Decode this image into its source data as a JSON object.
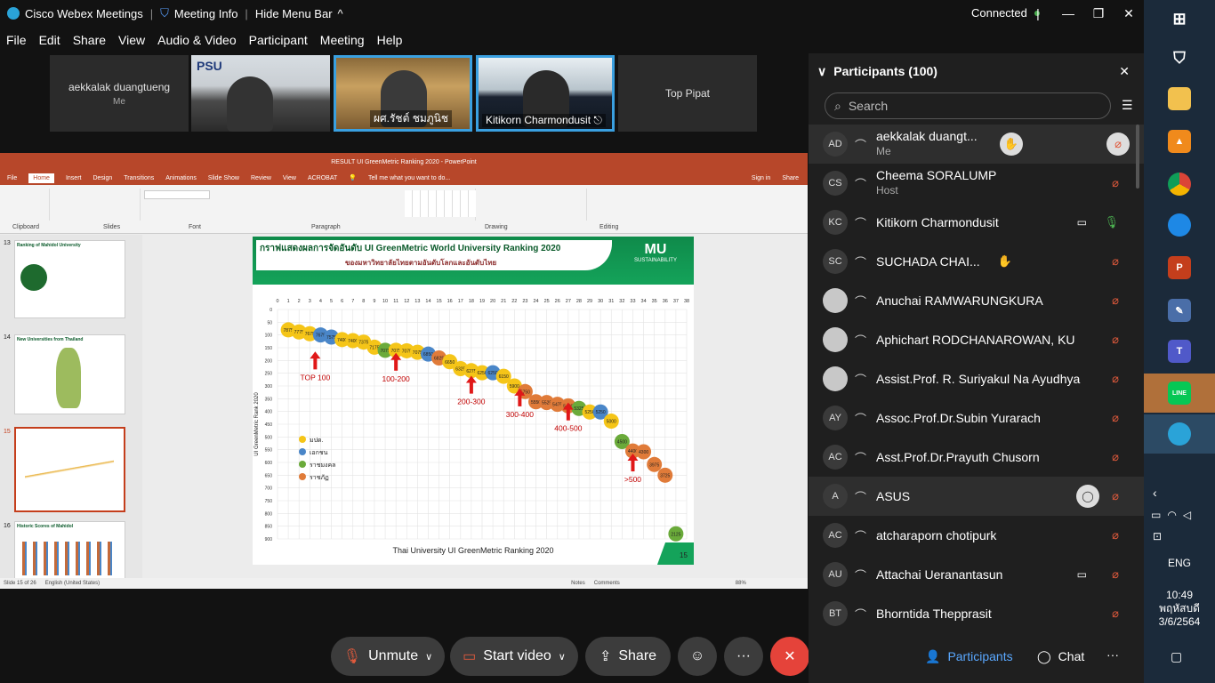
{
  "titlebar": {
    "app": "Cisco Webex Meetings",
    "meeting_info": "Meeting Info",
    "hide_menu": "Hide Menu Bar",
    "status": "Connected"
  },
  "menu": [
    "File",
    "Edit",
    "Share",
    "View",
    "Audio & Video",
    "Participant",
    "Meeting",
    "Help"
  ],
  "videos": [
    {
      "name": "aekkalak duangtueng",
      "sub": "Me"
    },
    {
      "name": "",
      "sub": ""
    },
    {
      "name": "ผศ.รัชต์ ชมภูนิช",
      "sub": ""
    },
    {
      "name": "Kitikorn Charmondusit",
      "sub": ""
    },
    {
      "name": "Top Pipat",
      "sub": ""
    }
  ],
  "ppt": {
    "window_title": "RESULT UI GreenMetric Ranking 2020 - PowerPoint",
    "tabs": [
      "File",
      "Home",
      "Insert",
      "Design",
      "Transitions",
      "Animations",
      "Slide Show",
      "Review",
      "View",
      "ACROBAT"
    ],
    "tell_me": "Tell me what you want to do...",
    "signin": "Sign in",
    "share": "Share",
    "groups": [
      "Clipboard",
      "Slides",
      "Font",
      "Paragraph",
      "Drawing",
      "Editing"
    ],
    "status": "Slide 15 of 26",
    "language": "English (United States)",
    "notes": "Notes",
    "comments": "Comments",
    "zoom": "88%",
    "thumbs": [
      {
        "num": "13",
        "title": "Ranking of Mahidol University"
      },
      {
        "num": "14",
        "title": "New Universities from Thailand"
      },
      {
        "num": "15",
        "title": ""
      },
      {
        "num": "16",
        "title": "Historic Scores of Mahidol"
      }
    ]
  },
  "slide": {
    "title_line1": "กราฟแสดงผลการจัดอันดับ UI GreenMetric World University Ranking 2020",
    "title_line2": "ของมหาวิทยาลัยไทยตามอันดับโลกและอันดับไทย",
    "logo_text": "MU",
    "logo_sub": "SUSTAINABILITY",
    "caption": "Thai University UI GreenMetric Ranking 2020",
    "page_no": "15",
    "legend": [
      "มปด.",
      "เอกชน",
      "ราชมงคล",
      "ราชภัฏ"
    ],
    "legend_colors": [
      "#f5c518",
      "#4a86c8",
      "#6aaa3a",
      "#e07b39"
    ],
    "bands": [
      "TOP 100",
      "100-200",
      "200-300",
      "300-400",
      "400-500",
      ">500"
    ]
  },
  "chart_data": {
    "type": "scatter",
    "title": "",
    "xlabel": "",
    "ylabel": "UI GreenMetric Rank 2020",
    "xlim": [
      0,
      38
    ],
    "ylim": [
      0,
      900
    ],
    "x_ticks": [
      0,
      1,
      2,
      3,
      4,
      5,
      6,
      7,
      8,
      9,
      10,
      11,
      12,
      13,
      14,
      15,
      16,
      17,
      18,
      19,
      20,
      21,
      22,
      23,
      24,
      25,
      26,
      27,
      28,
      29,
      30,
      31,
      32,
      33,
      34,
      35,
      36,
      37,
      38
    ],
    "y_ticks": [
      0,
      50,
      100,
      150,
      200,
      250,
      300,
      350,
      400,
      450,
      500,
      550,
      600,
      650,
      700,
      750,
      800,
      850,
      900
    ],
    "points": [
      {
        "x": 1,
        "y": 80,
        "label": "7875",
        "group": "มปด."
      },
      {
        "x": 2,
        "y": 88,
        "label": "7775",
        "group": "มปด."
      },
      {
        "x": 3,
        "y": 95,
        "label": "7675",
        "group": "มปด."
      },
      {
        "x": 4,
        "y": 100,
        "label": "7675",
        "group": "เอกชน"
      },
      {
        "x": 5,
        "y": 108,
        "label": "7575",
        "group": "เอกชน"
      },
      {
        "x": 6,
        "y": 118,
        "label": "7400",
        "group": "มปด."
      },
      {
        "x": 7,
        "y": 122,
        "label": "7400",
        "group": "มปด."
      },
      {
        "x": 8,
        "y": 128,
        "label": "7375",
        "group": "มปด."
      },
      {
        "x": 9,
        "y": 148,
        "label": "7175",
        "group": "มปด."
      },
      {
        "x": 10,
        "y": 160,
        "label": "7075",
        "group": "ราชมงคล"
      },
      {
        "x": 11,
        "y": 160,
        "label": "7075",
        "group": "มปด."
      },
      {
        "x": 12,
        "y": 162,
        "label": "7075",
        "group": "มปด."
      },
      {
        "x": 13,
        "y": 168,
        "label": "7075",
        "group": "มปด."
      },
      {
        "x": 14,
        "y": 175,
        "label": "6850",
        "group": "เอกชน"
      },
      {
        "x": 15,
        "y": 190,
        "label": "6825",
        "group": "ราชภัฏ"
      },
      {
        "x": 16,
        "y": 205,
        "label": "6650",
        "group": "มปด."
      },
      {
        "x": 17,
        "y": 232,
        "label": "6325",
        "group": "มปด."
      },
      {
        "x": 18,
        "y": 240,
        "label": "6275",
        "group": "มปด."
      },
      {
        "x": 19,
        "y": 248,
        "label": "6250",
        "group": "มปด."
      },
      {
        "x": 20,
        "y": 248,
        "label": "6250",
        "group": "เอกชน"
      },
      {
        "x": 21,
        "y": 262,
        "label": "6150",
        "group": "มปด."
      },
      {
        "x": 22,
        "y": 300,
        "label": "5900",
        "group": "มปด."
      },
      {
        "x": 23,
        "y": 322,
        "label": "5750",
        "group": "ราชภัฏ"
      },
      {
        "x": 24,
        "y": 362,
        "label": "5550",
        "group": "ราชภัฏ"
      },
      {
        "x": 25,
        "y": 365,
        "label": "5525",
        "group": "ราชภัฏ"
      },
      {
        "x": 26,
        "y": 372,
        "label": "5475",
        "group": "ราชภัฏ"
      },
      {
        "x": 27,
        "y": 378,
        "label": "5400",
        "group": "ราชภัฏ"
      },
      {
        "x": 28,
        "y": 388,
        "label": "5325",
        "group": "ราชมงคล"
      },
      {
        "x": 29,
        "y": 402,
        "label": "5250",
        "group": "มปด."
      },
      {
        "x": 30,
        "y": 402,
        "label": "5250",
        "group": "เอกชน"
      },
      {
        "x": 31,
        "y": 438,
        "label": "5000",
        "group": "มปด."
      },
      {
        "x": 32,
        "y": 518,
        "label": "4500",
        "group": "ราชมงคล"
      },
      {
        "x": 33,
        "y": 555,
        "label": "4400",
        "group": "ราชภัฏ"
      },
      {
        "x": 34,
        "y": 558,
        "label": "4300",
        "group": "ราชภัฏ"
      },
      {
        "x": 35,
        "y": 608,
        "label": "3975",
        "group": "ราชภัฏ"
      },
      {
        "x": 36,
        "y": 650,
        "label": "3725",
        "group": "ราชภัฏ"
      },
      {
        "x": 37,
        "y": 880,
        "label": "2125",
        "group": "ราชมงคล"
      }
    ]
  },
  "toolbar": {
    "unmute": "Unmute",
    "start_video": "Start video",
    "share": "Share",
    "participants": "Participants",
    "chat": "Chat"
  },
  "panel": {
    "title": "Participants (100)",
    "search_placeholder": "Search",
    "people": [
      {
        "initials": "AD",
        "name": "aekkalak duangt...",
        "sub": "Me",
        "hl": true,
        "hand": true
      },
      {
        "initials": "CS",
        "name": "Cheema SORALUMP",
        "sub": "Host"
      },
      {
        "initials": "KC",
        "name": "Kitikorn Charmondusit",
        "sub": "",
        "video": true
      },
      {
        "initials": "SC",
        "name": "SUCHADA CHAI...",
        "sub": "",
        "hand": true
      },
      {
        "initials": "",
        "name": "Anuchai RAMWARUNGKURA",
        "sub": ""
      },
      {
        "initials": "",
        "name": "Aphichart RODCHANAROWAN, KU",
        "sub": ""
      },
      {
        "initials": "",
        "name": "Assist.Prof. R. Suriyakul Na Ayudhya",
        "sub": ""
      },
      {
        "initials": "AY",
        "name": "Assoc.Prof.Dr.Subin Yurarach",
        "sub": ""
      },
      {
        "initials": "AC",
        "name": "Asst.Prof.Dr.Prayuth Chusorn",
        "sub": ""
      },
      {
        "initials": "A",
        "name": "ASUS",
        "sub": "",
        "hl": true,
        "chat": true
      },
      {
        "initials": "AC",
        "name": "atcharaporn chotipurk",
        "sub": ""
      },
      {
        "initials": "AU",
        "name": "Attachai Ueranantasun",
        "sub": "",
        "video": true
      },
      {
        "initials": "BT",
        "name": "Bhorntida Thepprasit",
        "sub": ""
      }
    ]
  },
  "taskbar": {
    "lang": "ENG",
    "time": "10:49",
    "day": "พฤหัสบดี",
    "date": "3/6/2564"
  }
}
